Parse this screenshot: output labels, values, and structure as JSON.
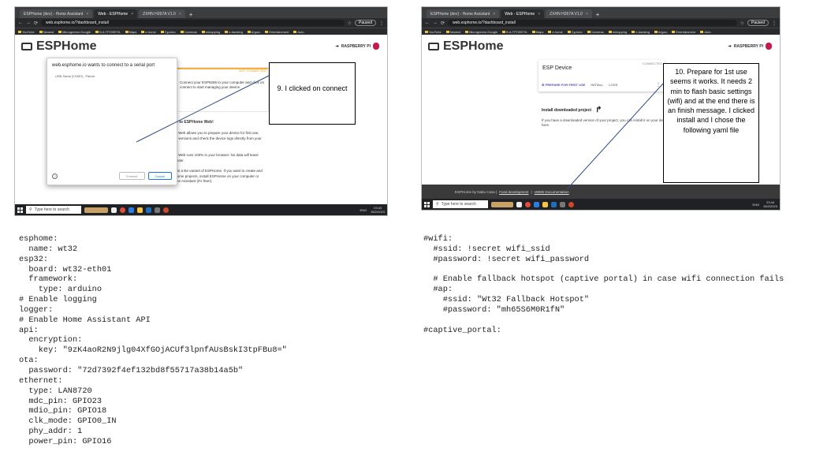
{
  "left": {
    "tabs": [
      {
        "label": "ESPHome (dev) - Home Assistant"
      },
      {
        "label": "Web - ESPHome"
      },
      {
        "label": "ZXHN H267A V1.0"
      }
    ],
    "url": "web.esphome.io/?dashboard_install",
    "profile": "Paused",
    "bookmarks": [
      "YouTube",
      "Newest",
      "Microgreens Google",
      "Β.Α.ΤΡΟΦΕΤΑ",
      "Maps",
      "e-home",
      "Σχολεία",
      "Cameras",
      "eshopping",
      "e-banking",
      "Δήμου",
      "Entertainment",
      "Auto"
    ],
    "brand": "ESPHome",
    "raspberry_label": "RASPBERRY PI",
    "dialog": {
      "title": "web.esphome.io wants to connect to a serial port",
      "port": "USB Serial (COM3) - Paired",
      "help": "?",
      "connect": "Connect",
      "cancel": "Cancel"
    },
    "card": {
      "status": "NOT CONNECTED",
      "text": "Connect your ESP8266 to your computer and click on connect to start managing your device."
    },
    "welcome_title": "Welcome to ESPHome Web!",
    "welcome_p1": "ESPHome Web allows you to prepare your device for first use, install new versions and check the device logs directly from your browser.",
    "welcome_p2": "ESPHome Web runs 100% in your browser. No data will leave your computer.",
    "welcome_p3": "This page is a lite variant of ESPHome. If you want to create and edit ESPHome projects, install ESPHome on your computer or inside Home Assistant (it's free!).",
    "callout": "9. I clicked on connect",
    "taskbar": {
      "search": "Type here to search",
      "lang": "ENG",
      "time": "23:43",
      "date": "28/2/2023"
    }
  },
  "right": {
    "tabs": [
      {
        "label": "ESPHome (dev) - Home Assistant"
      },
      {
        "label": "Web - ESPHome"
      },
      {
        "label": "ZXHN H267A V1.0"
      }
    ],
    "url": "web.esphome.io/?dashboard_install",
    "profile": "Paused",
    "bookmarks": [
      "YouTube",
      "Newest",
      "Microgreens Google",
      "Β.Α.ΤΡΟΦΕΤΑ",
      "Maps",
      "e-home",
      "Σχολεία",
      "Cameras",
      "eshopping",
      "e-banking",
      "Δήμου",
      "Entertainment",
      "Auto"
    ],
    "brand": "ESPHome",
    "raspberry_label": "RASPBERRY PI",
    "device": {
      "name": "ESP Device",
      "status": "CONNECTED",
      "prepare": "PREPARE FOR FIRST USE",
      "install": "INSTALL",
      "logs": "LOGS",
      "more": "⋮"
    },
    "install_title": "Install downloaded project",
    "install_text": "If you have a downloaded version of your project, you can install it on your device here.",
    "footer": {
      "by": "ESPHome by Nabu Casa |",
      "fund": "Fund development",
      "sep": "|",
      "docs": "vWEB Documentation"
    },
    "callout": "10. Prepare for 1st use seems it works. It needs 2 min to flash basic settings (wifi) and at the end there is an finish message. I clicked install and I chose the following yaml file",
    "taskbar": {
      "search": "Type here to search",
      "lang": "ENG",
      "time": "23:44",
      "date": "28/2/2023"
    }
  },
  "code_left": "esphome:\n  name: wt32\nesp32:\n  board: wt32-eth01\n  framework:\n    type: arduino\n# Enable logging\nlogger:\n# Enable Home Assistant API\napi:\n  encryption:\n    key: \"9zK4aoR2N9jlg04XfGOjACUf3lpnfAUsBskI3tpFBu8=\"\nota:\n  password: \"72d7392f4ef132bd8f55717a38b14a5b\"\nethernet:\n  type: LAN8720\n  mdc_pin: GPIO23\n  mdio_pin: GPIO18\n  clk_mode: GPIO0_IN\n  phy_addr: 1\n  power_pin: GPIO16",
  "code_right": "#wifi:\n  #ssid: !secret wifi_ssid\n  #password: !secret wifi_password\n\n  # Enable fallback hotspot (captive portal) in case wifi connection fails\n  #ap:\n    #ssid: \"Wt32 Fallback Hotspot\"\n    #password: \"mh65S6M0R1fN\"\n\n#captive_portal:"
}
